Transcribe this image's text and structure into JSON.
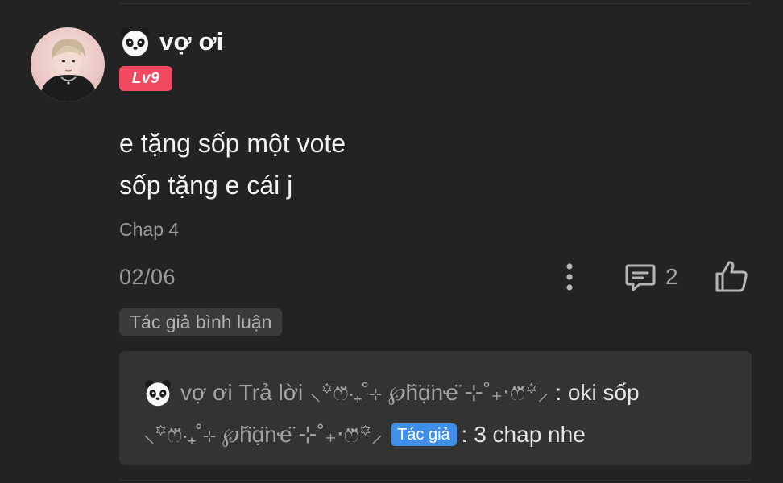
{
  "comment": {
    "username": "vợ ơi",
    "level": "Lv9",
    "text_lines": [
      "e tặng sốp một vote",
      "sốp tặng e cái j"
    ],
    "chapter": "Chap 4",
    "date": "02/06",
    "reply_count": "2",
    "author_comment_tag": "Tác giả bình luận",
    "icons": {
      "user_emoji": "panda-icon",
      "more": "more-vertical-icon",
      "reply": "comment-bubble-icon",
      "like": "thumbs-up-icon"
    }
  },
  "reply_preview": {
    "replier": "vợ ơi",
    "reply_word": "Trả lời",
    "target_user": "⸜꙳ෆ⃛‧₊˚⊹ ℘h̆̈ɑ̣̈nҽ̈ ⊹˚₊‧ෆ⃛꙳⸝",
    "message1": ": oki sốp",
    "author_user": "⸜꙳ෆ⃛‧₊˚⊹ ℘h̆̈ɑ̣̈nҽ̈ ⊹˚₊‧ෆ⃛꙳⸝",
    "author_badge": "Tác giả",
    "message2": ": 3 chap nhe"
  },
  "colors": {
    "background": "#232323",
    "level_badge": "#f1495f",
    "author_badge": "#3f8fe8",
    "reply_box": "#333333"
  }
}
